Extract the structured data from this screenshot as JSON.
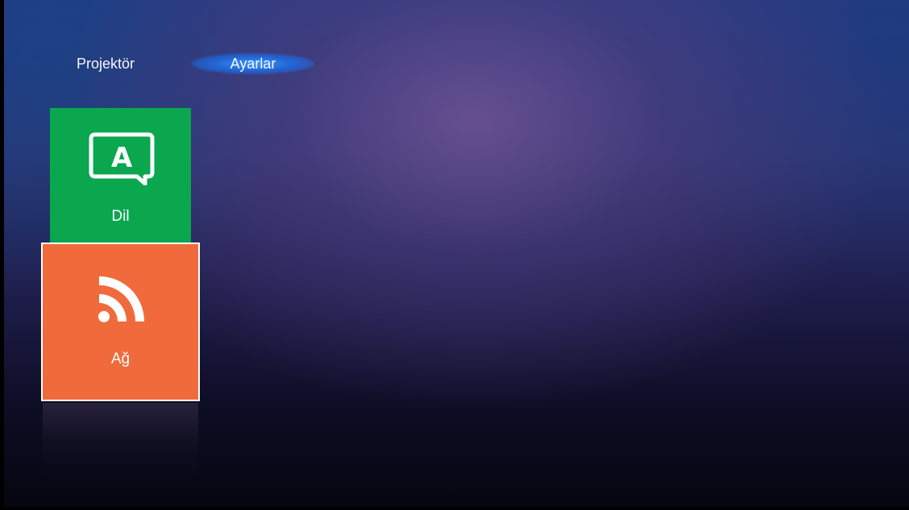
{
  "nav": {
    "items": [
      {
        "label": "Projektör"
      },
      {
        "label": "Ayarlar",
        "selected": true
      }
    ]
  },
  "tiles": [
    {
      "label": "Dil",
      "icon": "language-icon",
      "color": "#0aa74f"
    },
    {
      "label": "Ağ",
      "icon": "wifi-icon",
      "color": "#f06a3b",
      "focused": true
    }
  ],
  "colors": {
    "accent_glow": "#3c96ff",
    "focus_border": "#ffffff"
  }
}
